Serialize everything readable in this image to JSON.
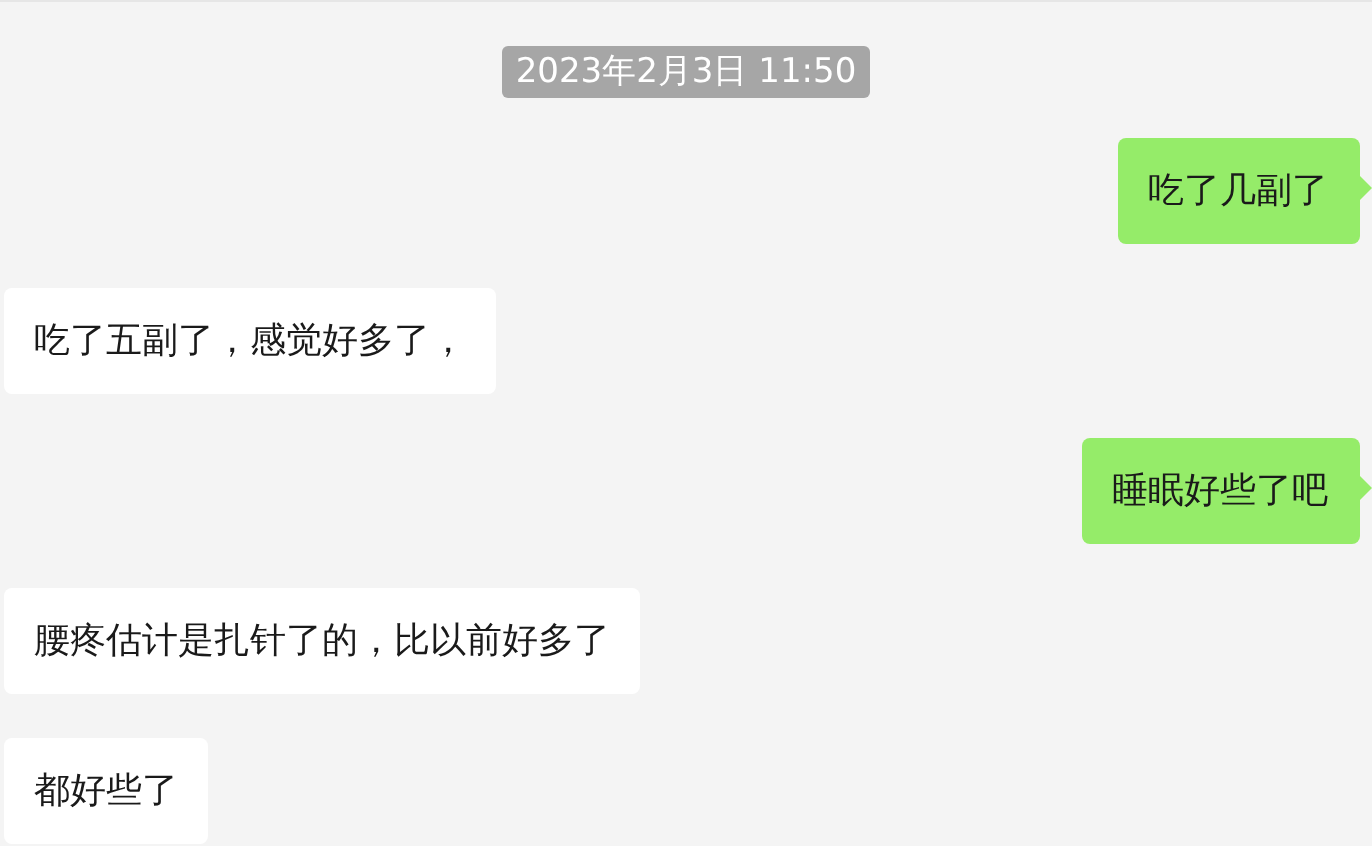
{
  "timestamp": "2023年2月3日 11:50",
  "messages": [
    {
      "kind": "sent",
      "text": "吃了几副了"
    },
    {
      "kind": "received",
      "text": "吃了五副了，感觉好多了，"
    },
    {
      "kind": "sent",
      "text": "睡眠好些了吧"
    },
    {
      "kind": "received",
      "text": "腰疼估计是扎针了的，比以前好多了"
    },
    {
      "kind": "received",
      "text": "都好些了"
    }
  ]
}
